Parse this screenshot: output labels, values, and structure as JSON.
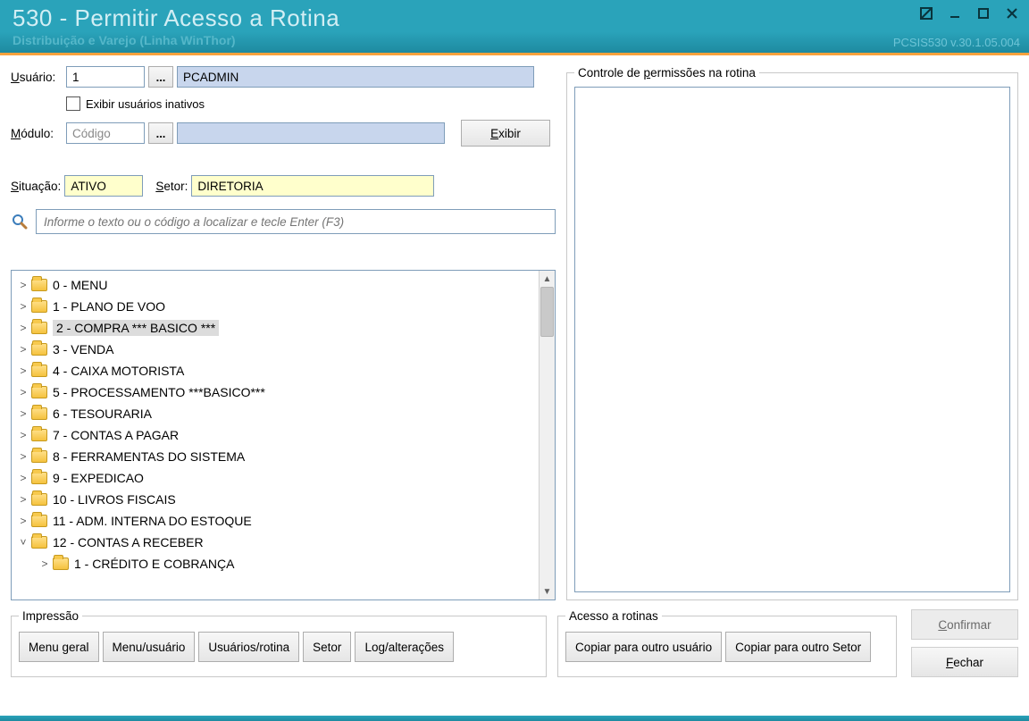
{
  "window": {
    "title": "530 - Permitir Acesso a Rotina",
    "subtitle": "Distribuição e Varejo (Linha WinThor)",
    "version": "PCSIS530  v.30.1.05.004"
  },
  "labels": {
    "usuario": "Usuário:",
    "exibir_inativos": "Exibir usuários inativos",
    "modulo": "Módulo:",
    "exibir_btn": "Exibir",
    "situacao": "Situação:",
    "setor": "Setor:",
    "search_placeholder": "Informe o texto ou o código a localizar e tecle Enter (F3)",
    "controle_perm": "Controle de permissões na rotina",
    "impressao": "Impressão",
    "acesso_rotinas": "Acesso a rotinas",
    "confirmar": "Confirmar",
    "fechar": "Fechar",
    "ellipsis": "..."
  },
  "fields": {
    "usuario_codigo": "1",
    "usuario_nome": "PCADMIN",
    "modulo_codigo": "Código",
    "modulo_nome": "",
    "situacao": "ATIVO",
    "setor": "DIRETORIA"
  },
  "impressao_buttons": [
    "Menu geral",
    "Menu/usuário",
    "Usuários/rotina",
    "Setor",
    "Log/alterações"
  ],
  "acesso_buttons": [
    "Copiar para outro usuário",
    "Copiar para outro Setor"
  ],
  "tree": [
    {
      "label": "0 - MENU",
      "expanded": false,
      "selected": false,
      "indent": 0
    },
    {
      "label": "1 - PLANO DE VOO",
      "expanded": false,
      "selected": false,
      "indent": 0
    },
    {
      "label": "2 - COMPRA              *** BASICO ***",
      "expanded": false,
      "selected": true,
      "indent": 0
    },
    {
      "label": "3 - VENDA",
      "expanded": false,
      "selected": false,
      "indent": 0
    },
    {
      "label": "4 - CAIXA MOTORISTA",
      "expanded": false,
      "selected": false,
      "indent": 0
    },
    {
      "label": "5 - PROCESSAMENTO ***BASICO***",
      "expanded": false,
      "selected": false,
      "indent": 0
    },
    {
      "label": "6 - TESOURARIA",
      "expanded": false,
      "selected": false,
      "indent": 0
    },
    {
      "label": "7 - CONTAS A PAGAR",
      "expanded": false,
      "selected": false,
      "indent": 0
    },
    {
      "label": "8 - FERRAMENTAS DO SISTEMA",
      "expanded": false,
      "selected": false,
      "indent": 0
    },
    {
      "label": "9 - EXPEDICAO",
      "expanded": false,
      "selected": false,
      "indent": 0
    },
    {
      "label": "10 - LIVROS FISCAIS",
      "expanded": false,
      "selected": false,
      "indent": 0
    },
    {
      "label": "11 - ADM. INTERNA DO ESTOQUE",
      "expanded": false,
      "selected": false,
      "indent": 0
    },
    {
      "label": "12 - CONTAS A RECEBER",
      "expanded": true,
      "selected": false,
      "indent": 0
    },
    {
      "label": "1 - CRÉDITO E COBRANÇA",
      "expanded": false,
      "selected": false,
      "indent": 1
    }
  ]
}
